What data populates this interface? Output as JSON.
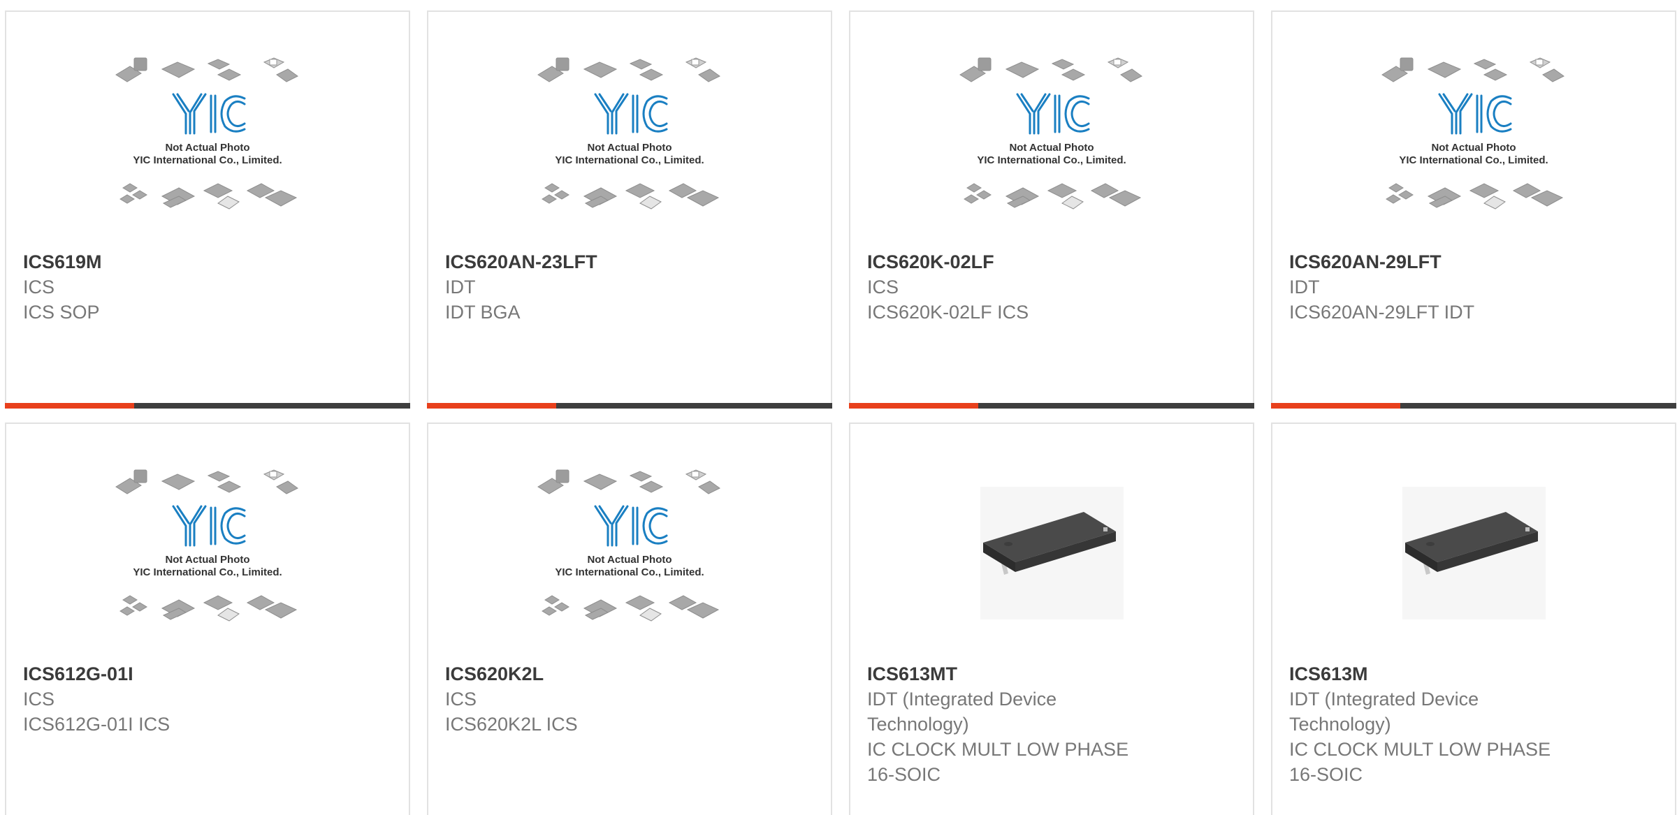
{
  "placeholder": {
    "line1": "Not Actual Photo",
    "line2": "YIC International Co., Limited.",
    "logo": "YIC"
  },
  "products": [
    {
      "part_number": "ICS619M",
      "manufacturer": "ICS",
      "description": "ICS SOP",
      "image": "placeholder"
    },
    {
      "part_number": "ICS620AN-23LFT",
      "manufacturer": "IDT",
      "description": "IDT BGA",
      "image": "placeholder"
    },
    {
      "part_number": "ICS620K-02LF",
      "manufacturer": "ICS",
      "description": "ICS620K-02LF ICS",
      "image": "placeholder"
    },
    {
      "part_number": "ICS620AN-29LFT",
      "manufacturer": "IDT",
      "description": "ICS620AN-29LFT IDT",
      "image": "placeholder"
    },
    {
      "part_number": "ICS612G-01I",
      "manufacturer": "ICS",
      "description": "ICS612G-01I ICS",
      "image": "placeholder"
    },
    {
      "part_number": "ICS620K2L",
      "manufacturer": "ICS",
      "description": "ICS620K2L ICS",
      "image": "placeholder"
    },
    {
      "part_number": "ICS613MT",
      "manufacturer": "IDT (Integrated Device Technology)",
      "description": "IC CLOCK MULT LOW PHASE 16-SOIC",
      "image": "soic-chip"
    },
    {
      "part_number": "ICS613M",
      "manufacturer": "IDT (Integrated Device Technology)",
      "description": "IC CLOCK MULT LOW PHASE 16-SOIC",
      "image": "soic-chip"
    }
  ],
  "colors": {
    "accent": "#e8401c",
    "bar": "#3e3e3e",
    "logo_blue": "#1a7fc2"
  }
}
